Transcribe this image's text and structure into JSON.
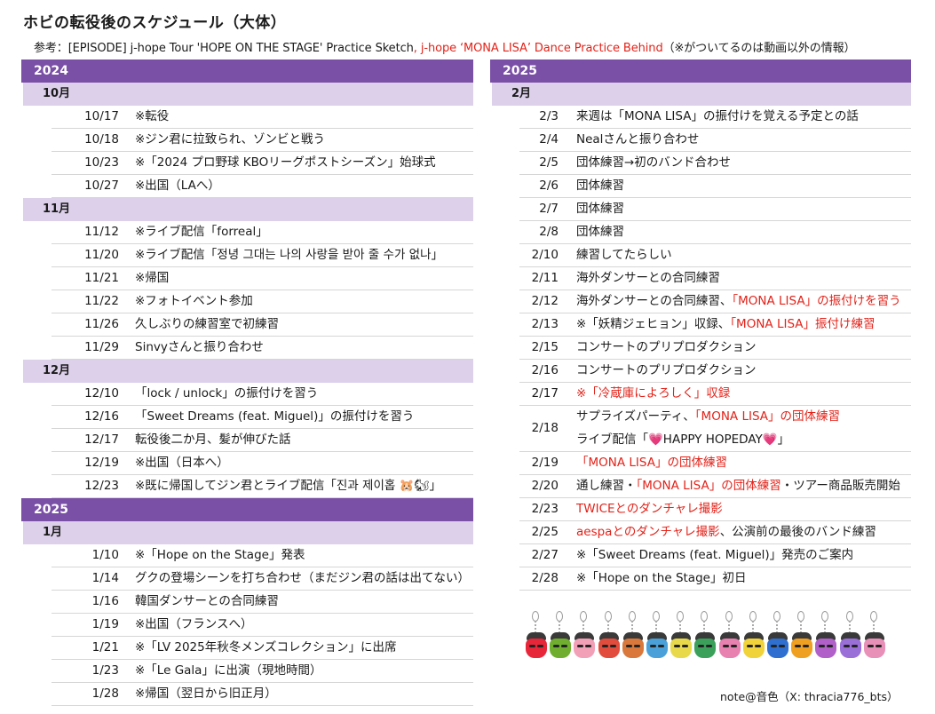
{
  "title": "ホビの転役後のスケジュール（大体）",
  "reference": {
    "prefix": "参考：[EPISODE] j-hope Tour 'HOPE ON THE STAGE' Practice Sketch",
    "red": ", j-hope ‘MONA LISA’ Dance Practice Behind",
    "suffix": "（※がついてるのは動画以外の情報）"
  },
  "colors": {
    "year_bar": "#7a4fa6",
    "month_bar": "#ddd0ea",
    "highlight": "#e2231a"
  },
  "left": {
    "sections": [
      {
        "year": "2024",
        "months": [
          {
            "month": "10月",
            "rows": [
              {
                "date": "10/17",
                "lines": [
                  [
                    {
                      "t": "※転役"
                    }
                  ]
                ]
              },
              {
                "date": "10/18",
                "lines": [
                  [
                    {
                      "t": "※ジン君に拉致られ、ゾンビと戦う"
                    }
                  ]
                ]
              },
              {
                "date": "10/23",
                "lines": [
                  [
                    {
                      "t": "※「2024 プロ野球 KBOリーグポストシーズン」始球式"
                    }
                  ]
                ]
              },
              {
                "date": "10/27",
                "lines": [
                  [
                    {
                      "t": "※出国（LAへ）"
                    }
                  ]
                ]
              }
            ]
          },
          {
            "month": "11月",
            "rows": [
              {
                "date": "11/12",
                "lines": [
                  [
                    {
                      "t": "※ライブ配信「forreal」"
                    }
                  ]
                ]
              },
              {
                "date": "11/20",
                "lines": [
                  [
                    {
                      "t": "※ライブ配信「정녕 그대는 나의 사랑을 받아 줄 수가 없나」"
                    }
                  ]
                ]
              },
              {
                "date": "11/21",
                "lines": [
                  [
                    {
                      "t": "※帰国"
                    }
                  ]
                ]
              },
              {
                "date": "11/22",
                "lines": [
                  [
                    {
                      "t": "※フォトイベント参加"
                    }
                  ]
                ]
              },
              {
                "date": "11/26",
                "lines": [
                  [
                    {
                      "t": "久しぶりの練習室で初練習"
                    }
                  ]
                ]
              },
              {
                "date": "11/29",
                "lines": [
                  [
                    {
                      "t": "Sinvyさんと振り合わせ"
                    }
                  ]
                ]
              }
            ]
          },
          {
            "month": "12月",
            "rows": [
              {
                "date": "12/10",
                "lines": [
                  [
                    {
                      "t": "「lock / unlock」の振付けを習う"
                    }
                  ]
                ]
              },
              {
                "date": "12/16",
                "lines": [
                  [
                    {
                      "t": "「Sweet Dreams (feat. Miguel)」の振付けを習う"
                    }
                  ]
                ]
              },
              {
                "date": "12/17",
                "lines": [
                  [
                    {
                      "t": "転役後二か月、髪が伸びた話"
                    }
                  ]
                ]
              },
              {
                "date": "12/19",
                "lines": [
                  [
                    {
                      "t": "※出国（日本へ）"
                    }
                  ]
                ]
              },
              {
                "date": "12/23",
                "lines": [
                  [
                    {
                      "t": "※既に帰国してジン君とライブ配信「진과 제이홉 🐹🐿」"
                    }
                  ]
                ]
              }
            ]
          }
        ]
      },
      {
        "year": "2025",
        "months": [
          {
            "month": "1月",
            "rows": [
              {
                "date": "1/10",
                "lines": [
                  [
                    {
                      "t": "※「Hope on the Stage」発表"
                    }
                  ]
                ]
              },
              {
                "date": "1/14",
                "lines": [
                  [
                    {
                      "t": "グクの登場シーンを打ち合わせ（まだジン君の話は出てない）"
                    }
                  ]
                ]
              },
              {
                "date": "1/16",
                "lines": [
                  [
                    {
                      "t": "韓国ダンサーとの合同練習"
                    }
                  ]
                ]
              },
              {
                "date": "1/19",
                "lines": [
                  [
                    {
                      "t": "※出国（フランスへ）"
                    }
                  ]
                ]
              },
              {
                "date": "1/21",
                "lines": [
                  [
                    {
                      "t": "※「LV 2025年秋冬メンズコレクション」に出席"
                    }
                  ]
                ]
              },
              {
                "date": "1/23",
                "lines": [
                  [
                    {
                      "t": "※「Le Gala」に出演（現地時間）"
                    }
                  ]
                ]
              },
              {
                "date": "1/28",
                "lines": [
                  [
                    {
                      "t": "※帰国（翌日から旧正月）"
                    }
                  ]
                ]
              }
            ]
          }
        ]
      }
    ]
  },
  "right": {
    "sections": [
      {
        "year": "2025",
        "months": [
          {
            "month": "2月",
            "rows": [
              {
                "date": "2/3",
                "lines": [
                  [
                    {
                      "t": "来週は「MONA LISA」の振付けを覚える予定との話"
                    }
                  ]
                ]
              },
              {
                "date": "2/4",
                "lines": [
                  [
                    {
                      "t": "Nealさんと振り合わせ"
                    }
                  ]
                ]
              },
              {
                "date": "2/5",
                "lines": [
                  [
                    {
                      "t": "団体練習→初のバンド合わせ"
                    }
                  ]
                ]
              },
              {
                "date": "2/6",
                "lines": [
                  [
                    {
                      "t": "団体練習"
                    }
                  ]
                ]
              },
              {
                "date": "2/7",
                "lines": [
                  [
                    {
                      "t": "団体練習"
                    }
                  ]
                ]
              },
              {
                "date": "2/8",
                "lines": [
                  [
                    {
                      "t": "団体練習"
                    }
                  ]
                ]
              },
              {
                "date": "2/10",
                "lines": [
                  [
                    {
                      "t": "練習してたらしい"
                    }
                  ]
                ]
              },
              {
                "date": "2/11",
                "lines": [
                  [
                    {
                      "t": "海外ダンサーとの合同練習"
                    }
                  ]
                ]
              },
              {
                "date": "2/12",
                "lines": [
                  [
                    {
                      "t": "海外ダンサーとの合同練習、"
                    },
                    {
                      "t": "「MONA LISA」の振付けを習う",
                      "red": true
                    }
                  ]
                ]
              },
              {
                "date": "2/13",
                "lines": [
                  [
                    {
                      "t": "※「妖精ジェヒョン」収録、"
                    },
                    {
                      "t": "「MONA LISA」振付け練習",
                      "red": true
                    }
                  ]
                ]
              },
              {
                "date": "2/15",
                "lines": [
                  [
                    {
                      "t": "コンサートのプリプロダクション"
                    }
                  ]
                ]
              },
              {
                "date": "2/16",
                "lines": [
                  [
                    {
                      "t": "コンサートのプリプロダクション"
                    }
                  ]
                ]
              },
              {
                "date": "2/17",
                "lines": [
                  [
                    {
                      "t": "※「冷蔵庫によろしく」収録",
                      "red": true
                    }
                  ]
                ]
              },
              {
                "date": "2/18",
                "lines": [
                  [
                    {
                      "t": "サプライズパーティ、"
                    },
                    {
                      "t": "「MONA LISA」の団体練習",
                      "red": true
                    }
                  ],
                  [
                    {
                      "t": "ライブ配信「💗HAPPY HOPEDAY💗」"
                    }
                  ]
                ]
              },
              {
                "date": "2/19",
                "lines": [
                  [
                    {
                      "t": "「MONA LISA」の団体練習",
                      "red": true
                    }
                  ]
                ]
              },
              {
                "date": "2/20",
                "lines": [
                  [
                    {
                      "t": "通し練習・"
                    },
                    {
                      "t": "「MONA LISA」の団体練習",
                      "red": true
                    },
                    {
                      "t": "・ツアー商品販売開始"
                    }
                  ]
                ]
              },
              {
                "date": "2/23",
                "lines": [
                  [
                    {
                      "t": "TWICEとのダンチャレ撮影",
                      "red": true
                    }
                  ]
                ]
              },
              {
                "date": "2/25",
                "lines": [
                  [
                    {
                      "t": "aespaとのダンチャレ撮影",
                      "red": true
                    },
                    {
                      "t": "、公演前の最後のバンド練習"
                    }
                  ]
                ]
              },
              {
                "date": "2/27",
                "lines": [
                  [
                    {
                      "t": "※「Sweet Dreams (feat. Miguel)」発売のご案内"
                    }
                  ]
                ]
              },
              {
                "date": "2/28",
                "lines": [
                  [
                    {
                      "t": "※「Hope on the Stage」初日"
                    }
                  ]
                ]
              }
            ]
          }
        ]
      }
    ]
  },
  "charm_colors": [
    "#e8263a",
    "#6fae2e",
    "#f2a0b8",
    "#e24c3c",
    "#d9783a",
    "#4aa0d8",
    "#e8d94a",
    "#3aa05a",
    "#e880b0",
    "#f0d23a",
    "#2e6fd0",
    "#f0a020",
    "#b060c8",
    "#9a6fd8",
    "#e890b8"
  ],
  "credit": "note@音色（X: thracia776_bts）"
}
